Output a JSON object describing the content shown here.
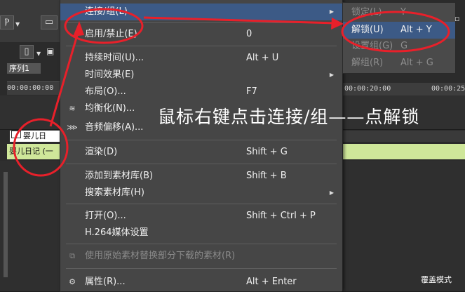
{
  "menu": {
    "items": [
      {
        "label": "连接/组(L)",
        "shortcut": "",
        "submenu": true,
        "state": "hover"
      },
      {
        "label": "启用/禁止(E)",
        "shortcut": "0",
        "submenu": false
      },
      {
        "label": "持续时间(U)...",
        "shortcut": "Alt + U",
        "submenu": false
      },
      {
        "label": "时间效果(E)",
        "shortcut": "",
        "submenu": true
      },
      {
        "label": "布局(O)...",
        "shortcut": "F7",
        "submenu": false
      },
      {
        "label": "均衡化(N)...",
        "shortcut": "",
        "submenu": false,
        "icon": "equalizer-icon"
      },
      {
        "label": "音频偏移(A)...",
        "shortcut": "",
        "submenu": false,
        "icon": "audio-offset-icon"
      },
      {
        "label": "渲染(D)",
        "shortcut": "Shift + G",
        "submenu": false
      },
      {
        "label": "添加到素材库(B)",
        "shortcut": "Shift + B",
        "submenu": false
      },
      {
        "label": "搜索素材库(H)",
        "shortcut": "",
        "submenu": true
      },
      {
        "label": "打开(O)...",
        "shortcut": "Shift + Ctrl + P",
        "submenu": false
      },
      {
        "label": "H.264媒体设置",
        "shortcut": "",
        "submenu": false
      },
      {
        "label": "使用原始素材替换部分下载的素材(R)",
        "shortcut": "",
        "submenu": false,
        "disabled": true,
        "icon": "replace-icon"
      },
      {
        "label": "属性(R)...",
        "shortcut": "Alt + Enter",
        "submenu": false,
        "icon": "properties-icon"
      }
    ]
  },
  "submenu": {
    "items": [
      {
        "label": "锁定(L)",
        "shortcut": "Y",
        "disabled": true
      },
      {
        "label": "解锁(U)",
        "shortcut": "Alt + Y",
        "selected": true
      },
      {
        "label": "设置组(G)",
        "shortcut": "G",
        "disabled": true
      },
      {
        "label": "解组(R)",
        "shortcut": "Alt + G",
        "disabled": true
      }
    ]
  },
  "timeline": {
    "tab": "序列1",
    "timecode_left": "00:00:00:00",
    "timecode_mid": "00:00:20:00",
    "timecode_right": "00:00:25",
    "clip_label": "婴儿日",
    "track_label": "婴儿日记 (一"
  },
  "annotation": "鼠标右键点击连接/组——点解锁",
  "watermark": "覆盖模式",
  "colors": {
    "annotation_red": "#e8202a",
    "menu_bg": "#464646",
    "highlight": "#3c5a86",
    "track_green": "#cfe79a"
  }
}
